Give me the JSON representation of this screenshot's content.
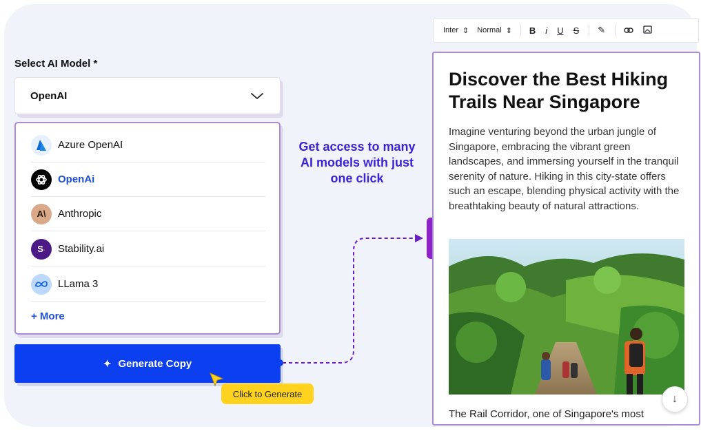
{
  "form": {
    "label": "Select AI Model *",
    "selected_value": "OpenAI"
  },
  "models": [
    {
      "label": "Azure OpenAI",
      "icon": "azure-logo-icon",
      "color": "#0a6ad6",
      "selected": false
    },
    {
      "label": "OpenAi",
      "icon": "openai-logo-icon",
      "color": "#000000",
      "selected": true
    },
    {
      "label": "Anthropic",
      "icon": "anthropic-logo-icon",
      "color": "#d6a98a",
      "selected": false
    },
    {
      "label": "Stability.ai",
      "icon": "stability-logo-icon",
      "color": "#4b1a86",
      "selected": false
    },
    {
      "label": "LLama 3",
      "icon": "meta-logo-icon",
      "color": "#9ec6f5",
      "selected": false
    }
  ],
  "more_link": "+ More",
  "generate_button": "Generate Copy",
  "tooltip": "Click to Generate",
  "callout": "Get access to many AI models with just one click",
  "toolbar": {
    "font": "Inter",
    "style": "Normal",
    "bold": "B",
    "italic": "i",
    "underline": "U",
    "strike": "S"
  },
  "editor": {
    "title": "Discover the Best Hiking Trails Near Singapore",
    "body": "Imagine venturing beyond the urban jungle of Singapore, embracing the vibrant green landscapes, and immersing yourself in the tranquil serenity of nature. Hiking in this city-state offers such an escape, blending physical activity with the breathtaking beauty of natural attractions.",
    "footer": "The Rail Corridor, one of Singapore's most"
  },
  "colors": {
    "accent_blue": "#0b3ff0",
    "purple": "#8f22c8",
    "tooltip_yellow": "#ffd21f",
    "callout": "#3a22d6"
  }
}
